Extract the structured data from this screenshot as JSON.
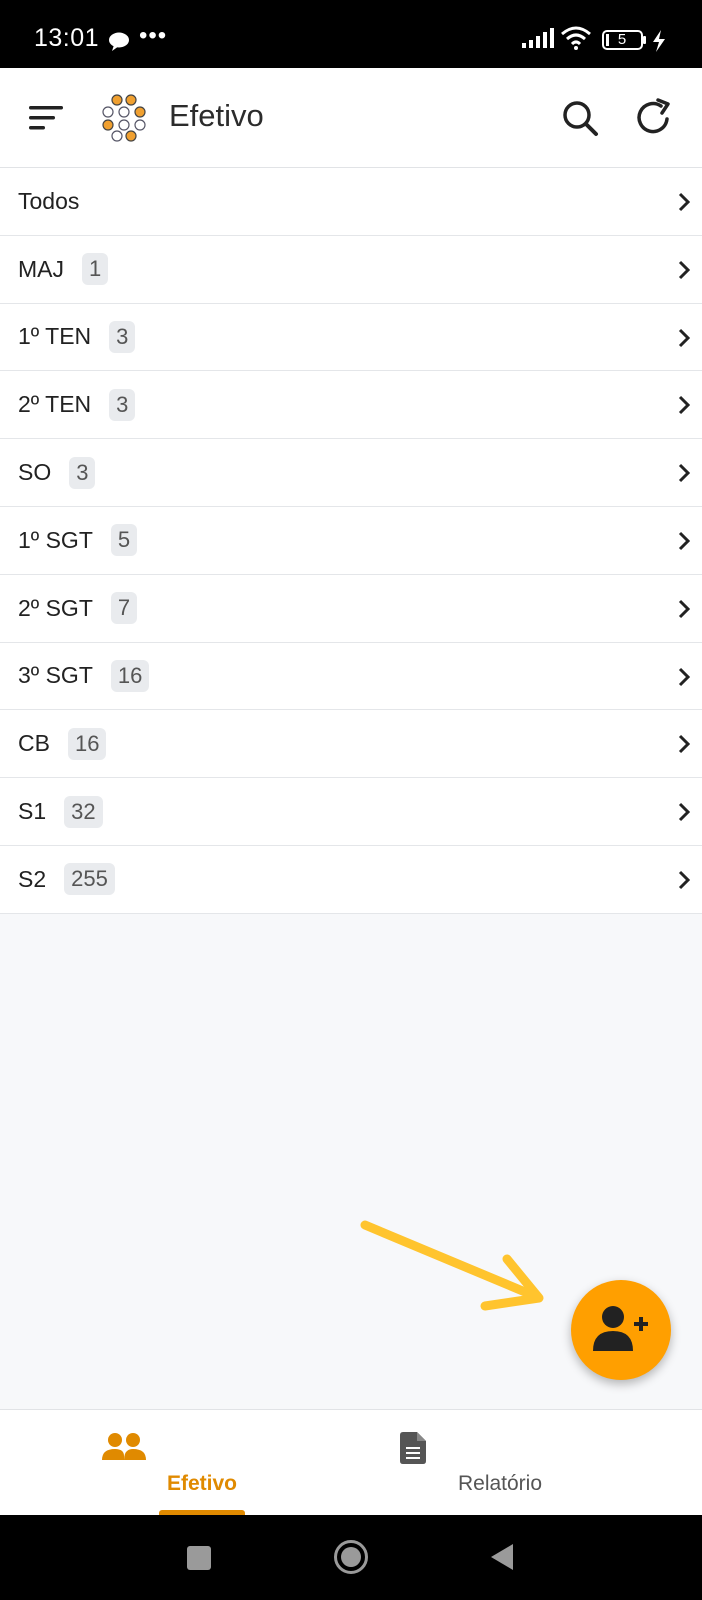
{
  "status_bar": {
    "time": "13:01",
    "dots": "•••",
    "battery": "5"
  },
  "app_bar": {
    "title": "Efetivo"
  },
  "list": [
    {
      "label": "Todos",
      "count": null
    },
    {
      "label": "MAJ",
      "count": "1"
    },
    {
      "label": "1º TEN",
      "count": "3"
    },
    {
      "label": "2º TEN",
      "count": "3"
    },
    {
      "label": "SO",
      "count": "3"
    },
    {
      "label": "1º SGT",
      "count": "5"
    },
    {
      "label": "2º SGT",
      "count": "7"
    },
    {
      "label": "3º SGT",
      "count": "16"
    },
    {
      "label": "CB",
      "count": "16"
    },
    {
      "label": "S1",
      "count": "32"
    },
    {
      "label": "S2",
      "count": "255"
    }
  ],
  "bottom_nav": {
    "efetivo": "Efetivo",
    "relatorio": "Relatório"
  },
  "colors": {
    "accent": "#ff9f00",
    "active_nav": "#e08a00",
    "arrow": "#ffc42e"
  },
  "icons": {
    "menu": "sort-menu-icon",
    "logo": "circle-network-logo",
    "search": "search-icon",
    "refresh": "refresh-icon",
    "chevron": "chevron-right-icon",
    "fab": "add-user-icon",
    "nav_efetivo": "users-icon",
    "nav_relatorio": "document-icon"
  }
}
